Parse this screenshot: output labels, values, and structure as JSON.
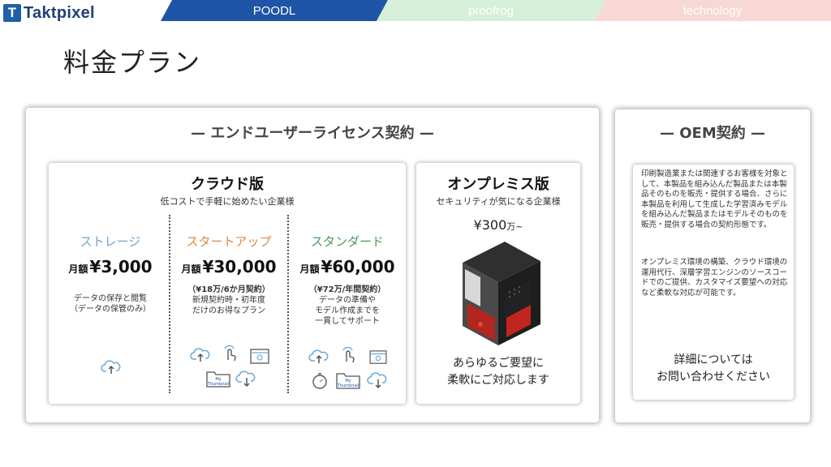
{
  "header": {
    "logo_mark": "T",
    "logo_text": "Taktpixel",
    "tabs": [
      {
        "label": "POODL"
      },
      {
        "label": "proofrog"
      },
      {
        "label": "technology"
      }
    ]
  },
  "page_title": "料金プラン",
  "end_user": {
    "heading": "— エンドユーザーライセンス契約 —",
    "cloud": {
      "title": "クラウド版",
      "subtitle": "低コストで手軽に始めたい企業様",
      "plans": [
        {
          "name": "ストレージ",
          "price_prefix": "月額",
          "price": "¥3,000",
          "notes": [
            "データの保存と閲覧",
            "（データの保管のみ）"
          ]
        },
        {
          "name": "スタートアップ",
          "price_prefix": "月額",
          "price": "¥30,000",
          "notes": [
            "（¥18万/6か月契約）",
            "新規契約時・初年度",
            "だけのお得なプラン"
          ]
        },
        {
          "name": "スタンダード",
          "price_prefix": "月額",
          "price": "¥60,000",
          "notes": [
            "（¥72万/年間契約）",
            "データの準備や",
            "モデル作成までを",
            "一貫してサポート"
          ]
        }
      ]
    },
    "onprem": {
      "title": "オンプレミス版",
      "subtitle": "セキュリティが気になる企業様",
      "price": "¥300",
      "price_unit": "万~",
      "message": [
        "あらゆるご要望に",
        "柔軟にご対応します"
      ]
    }
  },
  "oem": {
    "heading": "— OEM契約 —",
    "desc1": "印刷製造業または関連するお客様を対象として、本製品を組み込んだ製品または本製品そのものを販売・提供する場合、さらに本製品を利用して生成した学習済みモデルを組み込んだ製品またはモデルそのものを販売・提供する場合の契約形態です。",
    "desc2": "オンプレミス環境の構築、クラウド環境の運用代行、深層学習エンジンのソースコードでのご提供、カスタマイズ要望への対応など柔軟な対応が可能です。",
    "contact": [
      "詳細については",
      "お問い合わせください"
    ]
  },
  "icons": {
    "folder_label_1": "My",
    "folder_label_2": "Thumbnail"
  },
  "colors": {
    "tab_poodl": "#1f55a6",
    "tab_proofrog": "#d6efd8",
    "tab_technology": "#f8d8d4",
    "plan_storage": "#6fa4cf",
    "plan_startup": "#d98a48",
    "plan_standard": "#4a9a5c",
    "icon_blue": "#6aa9d8"
  }
}
